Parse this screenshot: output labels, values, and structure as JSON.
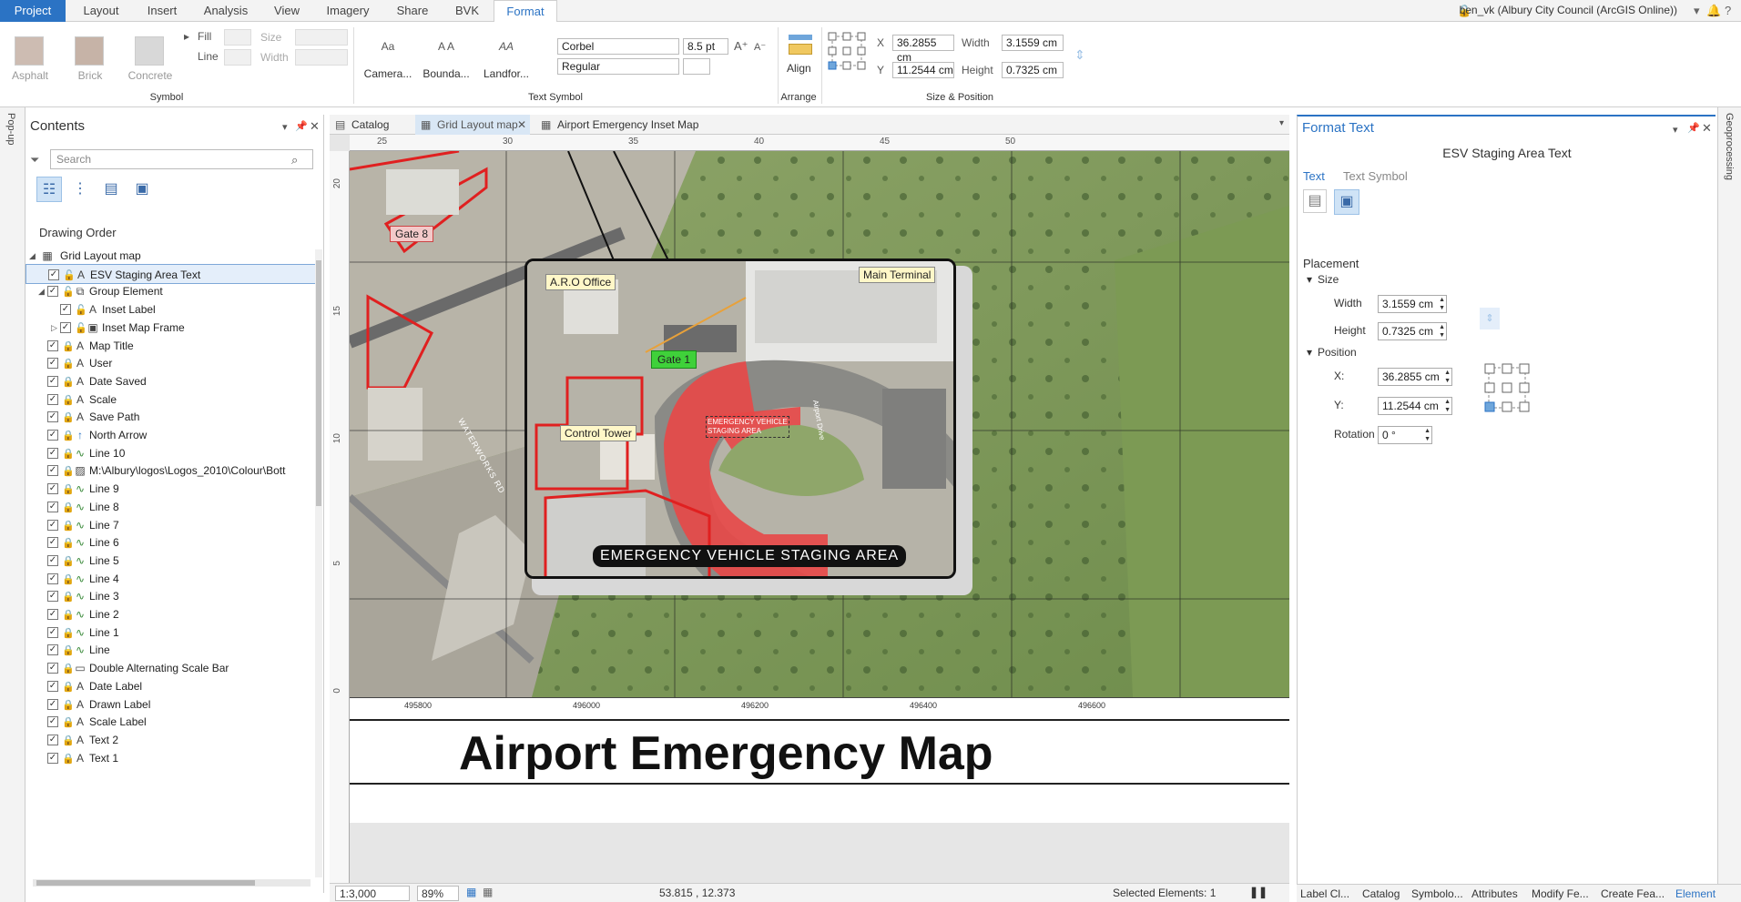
{
  "tabs": [
    "Project",
    "Layout",
    "Insert",
    "Analysis",
    "View",
    "Imagery",
    "Share",
    "BVK",
    "Format"
  ],
  "user": "ben_vk (Albury City Council (ArcGIS Online))",
  "ribbon": {
    "symbol": {
      "title": "Symbol",
      "swatches": [
        "Asphalt",
        "Brick",
        "Concrete"
      ],
      "fill_label": "Fill",
      "line_label": "Line",
      "size_label": "Size",
      "width_label": "Width"
    },
    "text_symbol": {
      "title": "Text Symbol",
      "buttons": [
        "Camera...",
        "Bounda...",
        "Landfor..."
      ],
      "font": "Corbel",
      "size": "8.5 pt",
      "style": "Regular"
    },
    "arrange": {
      "title": "Arrange",
      "align_label": "Align"
    },
    "size_position": {
      "title": "Size & Position",
      "x_label": "X",
      "x_value": "36.2855 cm",
      "y_label": "Y",
      "y_value": "11.2544 cm",
      "width_label": "Width",
      "width_value": "3.1559 cm",
      "height_label": "Height",
      "height_value": "0.7325 cm"
    }
  },
  "side_strip_label": "Pop-up",
  "right_strip_label": "Geoprocessing",
  "contents": {
    "title": "Contents",
    "search_placeholder": "Search",
    "drawing_order": "Drawing Order",
    "root": "Grid Layout map",
    "items": [
      {
        "label": "ESV Staging Area Text",
        "type": "text",
        "level": 1,
        "selected": true
      },
      {
        "label": "Group Element",
        "type": "group",
        "level": 1
      },
      {
        "label": "Inset Label",
        "type": "text",
        "level": 2
      },
      {
        "label": "Inset Map Frame",
        "type": "frame",
        "level": 2
      },
      {
        "label": "Map Title",
        "type": "text",
        "level": 1
      },
      {
        "label": "User",
        "type": "text",
        "level": 1
      },
      {
        "label": "Date Saved",
        "type": "text",
        "level": 1
      },
      {
        "label": "Scale",
        "type": "text",
        "level": 1
      },
      {
        "label": "Save Path",
        "type": "text",
        "level": 1
      },
      {
        "label": "North Arrow",
        "type": "arrow",
        "level": 1
      },
      {
        "label": "Line 10",
        "type": "line",
        "level": 1
      },
      {
        "label": "M:\\Albury\\logos\\Logos_2010\\Colour\\Bott",
        "type": "picture",
        "level": 1
      },
      {
        "label": "Line 9",
        "type": "line",
        "level": 1
      },
      {
        "label": "Line 8",
        "type": "line",
        "level": 1
      },
      {
        "label": "Line 7",
        "type": "line",
        "level": 1
      },
      {
        "label": "Line 6",
        "type": "line",
        "level": 1
      },
      {
        "label": "Line 5",
        "type": "line",
        "level": 1
      },
      {
        "label": "Line 4",
        "type": "line",
        "level": 1
      },
      {
        "label": "Line 3",
        "type": "line",
        "level": 1
      },
      {
        "label": "Line 2",
        "type": "line",
        "level": 1
      },
      {
        "label": "Line 1",
        "type": "line",
        "level": 1
      },
      {
        "label": "Line",
        "type": "line",
        "level": 1
      },
      {
        "label": "Double Alternating Scale Bar",
        "type": "scalebar",
        "level": 1
      },
      {
        "label": "Date Label",
        "type": "text",
        "level": 1
      },
      {
        "label": "Drawn Label",
        "type": "text",
        "level": 1
      },
      {
        "label": "Scale Label",
        "type": "text",
        "level": 1
      },
      {
        "label": "Text 2",
        "type": "text",
        "level": 1
      },
      {
        "label": "Text 1",
        "type": "text",
        "level": 1
      }
    ]
  },
  "view_tabs": [
    "Catalog",
    "Grid Layout map",
    "Airport Emergency Inset Map"
  ],
  "ruler": {
    "top": [
      "25",
      "30",
      "35",
      "40",
      "45",
      "50"
    ],
    "left": [
      "20",
      "15",
      "10",
      "5",
      "0"
    ]
  },
  "map": {
    "labels": {
      "gate8": "Gate 8",
      "aro": "A.R.O Office",
      "main_terminal": "Main Terminal",
      "gate1": "Gate 1",
      "control_tower": "Control Tower",
      "staging_small": "EMERGENCY VEHICLE STAGING AREA",
      "staging_banner": "EMERGENCY VEHICLE STAGING AREA",
      "road1": "WATERWORKS RD",
      "road2": "Airport Drive"
    },
    "coords": [
      "495800",
      "496000",
      "496200",
      "496400",
      "496600"
    ],
    "title": "Airport Emergency Map"
  },
  "status": {
    "scale": "1:3,000",
    "zoom": "89%",
    "coords": "53.815 , 12.373",
    "selected": "Selected Elements: 1"
  },
  "format_panel": {
    "title": "Format Text",
    "subtitle": "ESV Staging Area Text",
    "tab_text": "Text",
    "tab_symbol": "Text Symbol",
    "placement": "Placement",
    "size": "Size",
    "width_label": "Width",
    "width_value": "3.1559 cm",
    "height_label": "Height",
    "height_value": "0.7325 cm",
    "position": "Position",
    "x_label": "X:",
    "x_value": "36.2855 cm",
    "y_label": "Y:",
    "y_value": "11.2544 cm",
    "rotation_label": "Rotation",
    "rotation_value": "0 °"
  },
  "bottom_tabs": [
    "Label Cl...",
    "Catalog",
    "Symbolo...",
    "Attributes",
    "Modify Fe...",
    "Create Fea...",
    "Element"
  ],
  "colors": {
    "accent": "#2b73c4",
    "map_red": "#e03030",
    "gate_green": "#3fd13a",
    "label_yellow": "#fff7c8"
  }
}
